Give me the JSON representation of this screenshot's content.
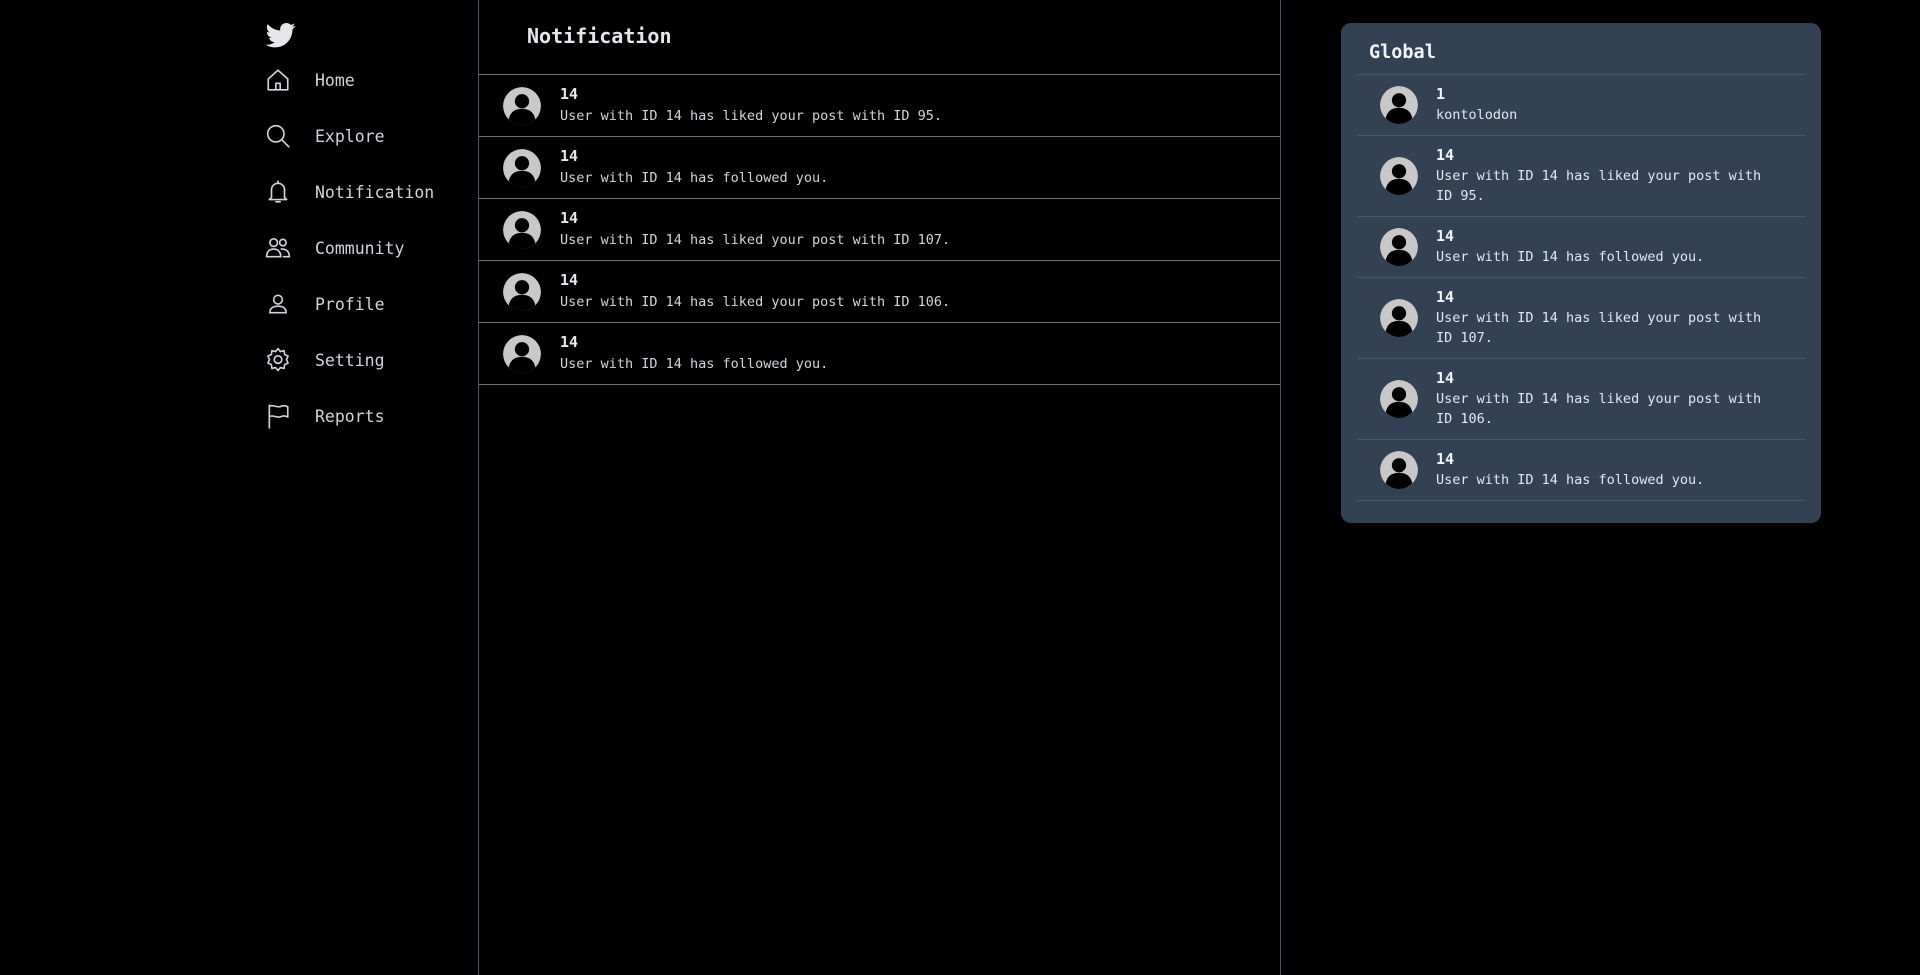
{
  "sidebar": {
    "logo_icon": "twitter-bird-icon",
    "items": [
      {
        "label": "Home",
        "icon": "home-icon"
      },
      {
        "label": "Explore",
        "icon": "search-icon"
      },
      {
        "label": "Notification",
        "icon": "bell-icon"
      },
      {
        "label": "Community",
        "icon": "users-icon"
      },
      {
        "label": "Profile",
        "icon": "user-icon"
      },
      {
        "label": "Setting",
        "icon": "gear-icon"
      },
      {
        "label": "Reports",
        "icon": "flag-icon"
      }
    ]
  },
  "main": {
    "title": "Notification",
    "notifications": [
      {
        "user": "14",
        "message": "User with ID 14 has liked your post with ID 95."
      },
      {
        "user": "14",
        "message": "User with ID 14 has followed you."
      },
      {
        "user": "14",
        "message": "User with ID 14 has liked your post with ID 107."
      },
      {
        "user": "14",
        "message": "User with ID 14 has liked your post with ID 106."
      },
      {
        "user": "14",
        "message": "User with ID 14 has followed you."
      }
    ]
  },
  "global": {
    "title": "Global",
    "items": [
      {
        "user": "1",
        "message": "kontolodon"
      },
      {
        "user": "14",
        "message": "User with ID 14 has liked your post with ID 95."
      },
      {
        "user": "14",
        "message": "User with ID 14 has followed you."
      },
      {
        "user": "14",
        "message": "User with ID 14 has liked your post with ID 107."
      },
      {
        "user": "14",
        "message": "User with ID 14 has liked your post with ID 106."
      },
      {
        "user": "14",
        "message": "User with ID 14 has followed you."
      }
    ]
  },
  "colors": {
    "background": "#000000",
    "panel": "#334155",
    "divider": "#6b7280",
    "text": "#e5e7eb"
  }
}
